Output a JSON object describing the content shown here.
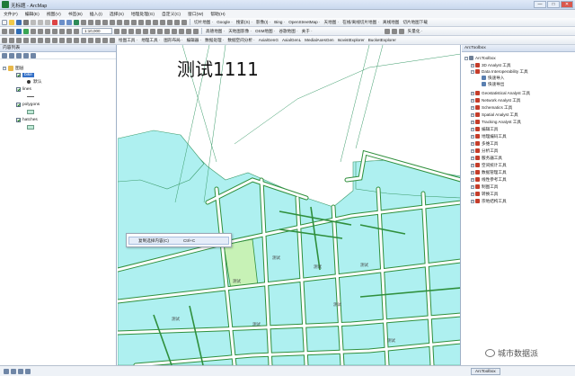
{
  "window": {
    "title": "无标题 - ArcMap",
    "buttons": [
      "—",
      "□",
      "✕"
    ]
  },
  "menubar": {
    "items": [
      "文件(F)",
      "编辑(E)",
      "视图(V)",
      "书签(B)",
      "插入(I)",
      "选择(S)",
      "地理处理(G)",
      "自定义(C)",
      "窗口(W)",
      "帮助(H)"
    ]
  },
  "toolbar1": {
    "items": [
      "切片地图 ·",
      "Google ·",
      "搜索(S) ·",
      "影像(I) ·",
      "Bing ·",
      "OpenStreetMap ·",
      "天地图 ·",
      "在线/离线切片地图 ·",
      "离线地图",
      "切片地图下载"
    ]
  },
  "toolbar2": {
    "scale": "1:10,000",
    "items": [
      "高德地图 ·",
      "天地图影像 ·",
      "OSM地图 ·",
      "谷歌地图 ·",
      "关于 ·"
    ],
    "extra": "矢量化 ·"
  },
  "toolbar3": {
    "items": [
      "编辑器 ·",
      "数据处理 ·",
      "数据空间分析 ·",
      "AxialGenG",
      "AxialGenL",
      "MedialAxesGen",
      "IsovistExplorer",
      "BucketExplorer"
    ],
    "left_items": [
      "绘图工具 ·",
      "地理工具 ·",
      "图形布局 ·"
    ]
  },
  "toc": {
    "title": "内容列表",
    "layers_root": "图层",
    "layers": [
      {
        "name": "bike",
        "legend": "默认"
      },
      {
        "name": "lines"
      },
      {
        "name": "polygons"
      },
      {
        "name": "hatches"
      }
    ]
  },
  "map": {
    "overlay_text": "测试1111",
    "labels": [
      "测试",
      "测试",
      "测试",
      "测试",
      "测试",
      "测试",
      "测试",
      "测试"
    ]
  },
  "context_menu": {
    "item_label": "复制选择内容(C)",
    "shortcut": "Ctrl+C"
  },
  "toolbox": {
    "title": "ArcToolbox",
    "root": "ArcToolbox",
    "items": [
      {
        "label": "3D Analyst 工具",
        "indent": 1
      },
      {
        "label": "Data Interoperability 工具",
        "indent": 1
      },
      {
        "label": "快速导入",
        "indent": 2
      },
      {
        "label": "快速导出",
        "indent": 2
      },
      {
        "label": "Geostatistical Analyst 工具",
        "indent": 1
      },
      {
        "label": "Network Analyst 工具",
        "indent": 1
      },
      {
        "label": "Schematics 工具",
        "indent": 1
      },
      {
        "label": "Spatial Analyst 工具",
        "indent": 1
      },
      {
        "label": "Tracking Analyst 工具",
        "indent": 1
      },
      {
        "label": "编辑工具",
        "indent": 1
      },
      {
        "label": "地理编码工具",
        "indent": 1
      },
      {
        "label": "多维工具",
        "indent": 1
      },
      {
        "label": "分析工具",
        "indent": 1
      },
      {
        "label": "服务器工具",
        "indent": 1
      },
      {
        "label": "空间统计工具",
        "indent": 1
      },
      {
        "label": "数据管理工具",
        "indent": 1
      },
      {
        "label": "线性参考工具",
        "indent": 1
      },
      {
        "label": "制图工具",
        "indent": 1
      },
      {
        "label": "转换工具",
        "indent": 1
      },
      {
        "label": "宗地结构工具",
        "indent": 1
      }
    ]
  },
  "statusbar": {
    "tabs": [
      "ArcToolbox"
    ],
    "watermark": "城市数据派"
  },
  "colors": {
    "polygon_fill": "#aef0f0",
    "polygon_selected": "#c7f2b6",
    "road": "#ffffff",
    "road_edge": "#2f8f3c"
  }
}
